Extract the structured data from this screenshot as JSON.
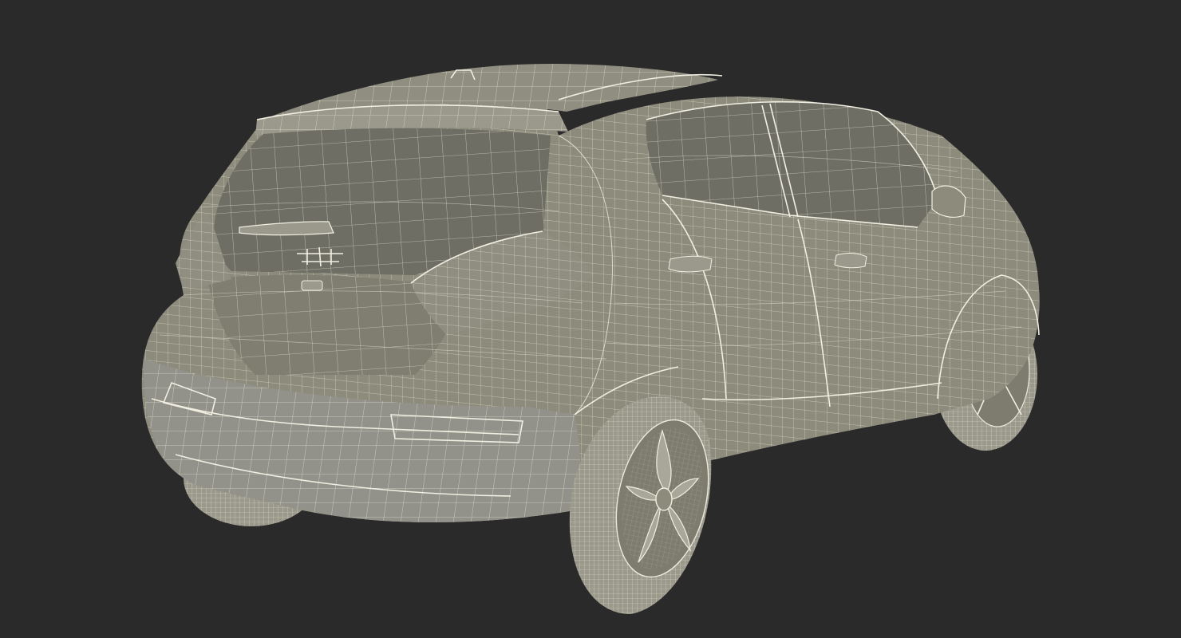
{
  "scene": {
    "background_color": "#2a2a2a",
    "body_color": "#8c8b7c",
    "glass_color": "#6f6e64",
    "wire_color": "#e9e7d8",
    "tire_color": "#9a998b"
  }
}
